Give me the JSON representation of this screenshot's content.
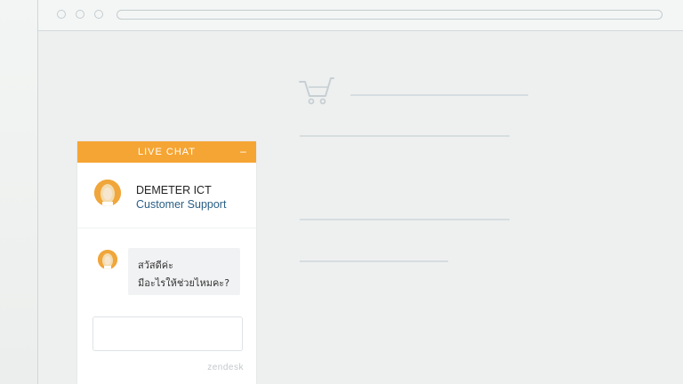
{
  "chat": {
    "header_title": "LIVE CHAT",
    "minimize_symbol": "–",
    "agent": {
      "name": "DEMETER ICT",
      "role": "Customer Support"
    },
    "message": {
      "line1": "สวัสดีค่ะ",
      "line2": "มีอะไรให้ช่วยไหมคะ?"
    },
    "input": {
      "value": "",
      "placeholder": ""
    },
    "brand": "zendesk"
  },
  "icons": {
    "cart": "shopping-cart-icon",
    "minimize": "minimize-icon",
    "avatar": "agent-avatar"
  },
  "colors": {
    "accent": "#f5a533",
    "role_text": "#2a5f86",
    "placeholder_lines": "#d6dde0",
    "browser_outline": "#c3ccd0"
  }
}
